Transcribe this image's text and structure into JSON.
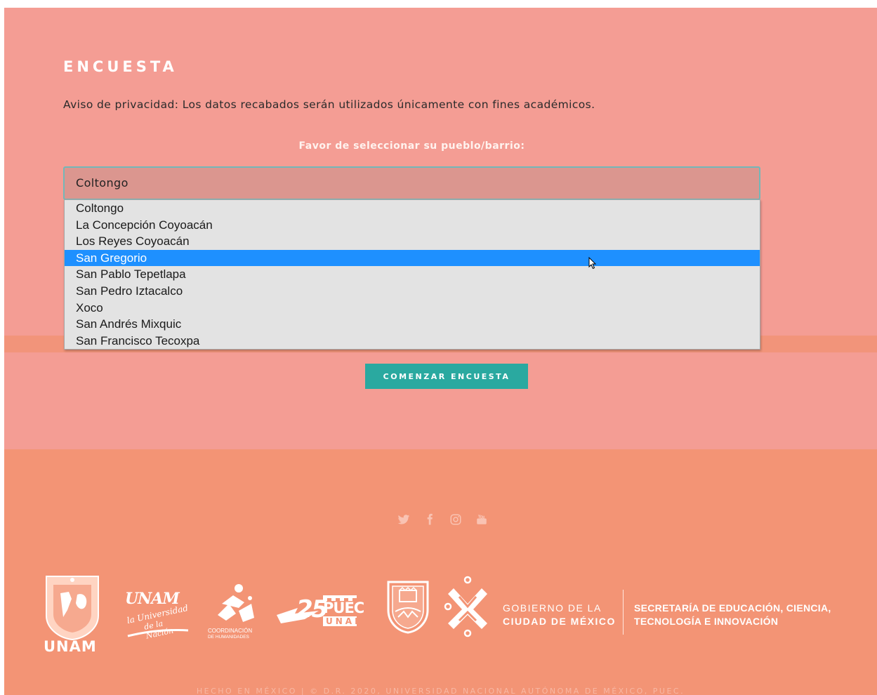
{
  "survey": {
    "title": "ENCUESTA",
    "privacy_notice": "Aviso de privacidad: Los datos recabados serán utilizados únicamente con fines académicos.",
    "select_prompt": "Favor de seleccionar su pueblo/barrio:",
    "select_value": "Coltongo",
    "options": [
      "Coltongo",
      "La Concepción Coyoacán",
      "Los Reyes Coyoacán",
      "San Gregorio",
      "San Pablo Tepetlapa",
      "San Pedro Iztacalco",
      "Xoco",
      "San Andrés Mixquic",
      "San Francisco Tecoxpa"
    ],
    "highlighted_option": "San Gregorio",
    "start_button": "COMENZAR ENCUESTA"
  },
  "footer": {
    "social_icons": [
      "twitter-icon",
      "facebook-icon",
      "instagram-icon",
      "youtube-icon"
    ],
    "logos": {
      "unam_wordmark": "UNAM",
      "puec_number": "25",
      "puec_name": "PUEC",
      "puec_unam": "UNAM",
      "coord_line1": "COORDINACIÓN",
      "coord_line2": "DE HUMANIDADES",
      "unam_script": "UNAM",
      "unam_tagline_1": "la Universidad",
      "unam_tagline_2": "de la Nación"
    },
    "gob_line1": "GOBIERNO DE LA",
    "gob_line2": "CIUDAD DE MÉXICO",
    "secretaria_line1": "SECRETARÍA DE EDUCACIÓN, CIENCIA,",
    "secretaria_line2": "TECNOLOGÍA E INNOVACIÓN",
    "copyright": "HECHO EN MÉXICO | © D.R. 2020, UNIVERSIDAD NACIONAL AUTÓNOMA DE MÉXICO, PUEC."
  },
  "colors": {
    "page_bg": "#f49d94",
    "footer_bg": "#f39475",
    "button_bg": "#2aa9a0",
    "highlight": "#1e90ff"
  }
}
